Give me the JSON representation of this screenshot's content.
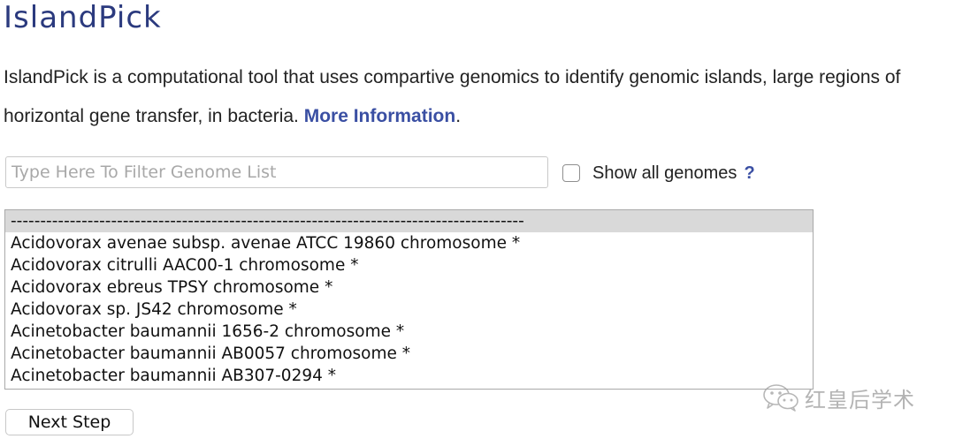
{
  "page": {
    "title": "IslandPick"
  },
  "intro": {
    "text": "IslandPick is a computational tool that uses compartive genomics to identify genomic islands, large regions of horizontal gene transfer, in bacteria. ",
    "link_label": "More Information",
    "suffix": "."
  },
  "filter": {
    "placeholder": "Type Here To Filter Genome List",
    "value": ""
  },
  "show_all": {
    "label": "Show all genomes",
    "checked": false,
    "help_label": "?"
  },
  "genome_list": {
    "options": [
      {
        "label": "---------------------------------------------------------------------------------------",
        "selected": true
      },
      {
        "label": "Acidovorax avenae subsp. avenae ATCC 19860 chromosome *",
        "selected": false
      },
      {
        "label": "Acidovorax citrulli AAC00-1 chromosome *",
        "selected": false
      },
      {
        "label": "Acidovorax ebreus TPSY chromosome *",
        "selected": false
      },
      {
        "label": "Acidovorax sp. JS42 chromosome *",
        "selected": false
      },
      {
        "label": "Acinetobacter baumannii 1656-2 chromosome *",
        "selected": false
      },
      {
        "label": "Acinetobacter baumannii AB0057 chromosome *",
        "selected": false
      },
      {
        "label": "Acinetobacter baumannii AB307-0294 *",
        "selected": false
      }
    ]
  },
  "actions": {
    "next_label": "Next Step"
  },
  "watermark": {
    "icon": "wechat-icon",
    "text": "红皇后学术"
  },
  "colors": {
    "title": "#2b3a7e",
    "link": "#3a4fa3",
    "selected_row": "#d9d9d9"
  }
}
